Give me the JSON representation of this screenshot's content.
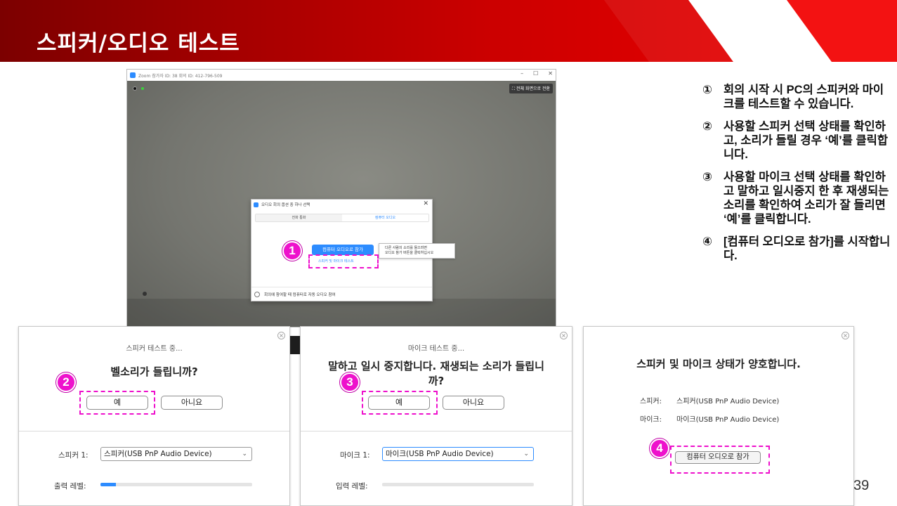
{
  "header": {
    "title": "스피커/오디오 테스트"
  },
  "zoom_window": {
    "title": "Zoom 참가자 ID: 38   회의 ID: 412-796-509",
    "fullscreen_label": "전체 화면으로 전환",
    "window_controls": [
      "–",
      "☐",
      "✕"
    ]
  },
  "audio_dialog": {
    "title": "오디오 회의 옵션 중 하나 선택",
    "close": "✕",
    "tabs": [
      {
        "label": "전화 통화"
      },
      {
        "label": "컴퓨터 오디오"
      }
    ],
    "join_button": "컴퓨터 오디오로 참가",
    "test_link": "스피커 및 마이크 테스트",
    "tooltip_line1": "다른 사람의 소리를 들으려면",
    "tooltip_line2": "오디오 참가 버튼을 클릭하십시오",
    "auto_join_label": "회의에 참여할 때 컴퓨터로 자동 오디오 참여"
  },
  "markers": [
    "1",
    "2",
    "3",
    "4"
  ],
  "instructions": [
    {
      "num": "①",
      "text": "회의 시작 시 PC의 스피커와 마이크를 테스트할 수 있습니다."
    },
    {
      "num": "②",
      "text": "사용할 스피커 선택 상태를 확인하고, 소리가 들릴 경우 ‘예’를 클릭합니다."
    },
    {
      "num": "③",
      "text": "사용할 마이크 선택 상태를 확인하고 말하고 일시중지 한 후 재생되는 소리를 확인하여 소리가 잘 들리면 ‘예’를 클릭합니다."
    },
    {
      "num": "④",
      "text": "[컴퓨터 오디오로 참가]를 시작합니다."
    }
  ],
  "speaker_panel": {
    "close": "×",
    "status": "스피커 테스트 중...",
    "question": "벨소리가 들립니까?",
    "yes": "예",
    "no": "아니요",
    "device_label": "스피커 1:",
    "device_value": "스피커(USB PnP Audio Device)",
    "level_label": "출력 레벨:",
    "level": 0.1
  },
  "mic_panel": {
    "close": "×",
    "status": "마이크 테스트 중...",
    "question_line1": "말하고 일시 중지합니다. 재생되는 소리가 들립니",
    "question_line2": "까?",
    "yes": "예",
    "no": "아니요",
    "device_label": "마이크 1:",
    "device_value": "마이크(USB PnP Audio Device)",
    "level_label": "입력 레벨:",
    "level": 0
  },
  "result_panel": {
    "close": "×",
    "title": "스피커 및 마이크 상태가 양호합니다.",
    "speaker_label": "스피커:",
    "speaker_value": "스피커(USB PnP Audio Device)",
    "mic_label": "마이크:",
    "mic_value": "마이크(USB PnP Audio Device)",
    "join_button": "컴퓨터 오디오로 참가"
  },
  "page_number": "39",
  "colors": {
    "accent": "#2d8cff",
    "marker": "#ee11cc",
    "banner": "#cc0000"
  }
}
